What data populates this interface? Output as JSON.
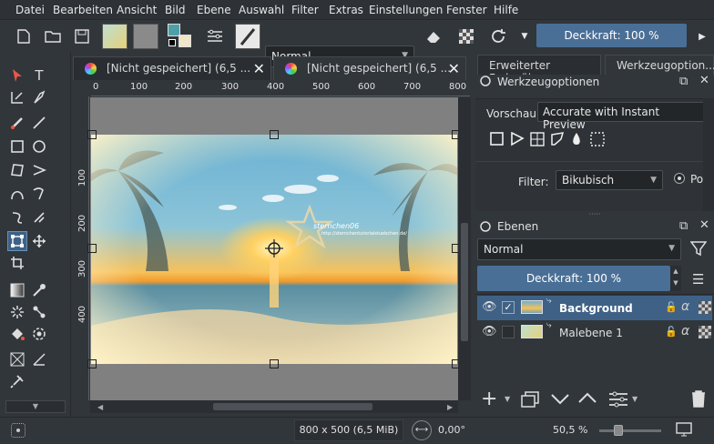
{
  "menu": [
    "Datei",
    "Bearbeiten",
    "Ansicht",
    "Bild",
    "Ebene",
    "Auswahl",
    "Filter",
    "Extras",
    "Einstellungen",
    "Fenster",
    "Hilfe"
  ],
  "toolbar": {
    "blend_mode": "Normal",
    "opacity_label": "Deckkraft: 100 %"
  },
  "document_tabs": [
    {
      "title": "[Nicht gespeichert] (6,5 ..."
    },
    {
      "title": "[Nicht gespeichert] (6,5 ..."
    }
  ],
  "rulers": {
    "top": [
      "0",
      "100",
      "200",
      "300",
      "400",
      "500",
      "600",
      "700",
      "800"
    ],
    "left": [
      "100",
      "200",
      "300",
      "400"
    ]
  },
  "canvas": {
    "watermark": "sternchen06",
    "watermark_url": "http://sternchentutorialstuebchen.de/"
  },
  "right_panel": {
    "tabs": [
      "Erweiterter Farbwäh...",
      "Werkzeugoption..."
    ],
    "tool_options": {
      "title": "Werkzeugoptionen",
      "preview_label": "Vorschau",
      "preview_value": "Accurate with Instant Preview",
      "filter_label": "Filter:",
      "filter_value": "Bikubisch",
      "radio_label": "Po"
    },
    "layers": {
      "title": "Ebenen",
      "blend_mode": "Normal",
      "opacity_label": "Deckkraft:  100 %",
      "items": [
        {
          "name": "Background"
        },
        {
          "name": "Malebene 1"
        }
      ]
    }
  },
  "status": {
    "size": "800 x 500 (6,5 MiB)",
    "angle": "0,00°",
    "zoom": "50,5 %"
  },
  "colors": {
    "accent": "#4a6f96",
    "bg": "#31363b",
    "selected_row": "#3f6186"
  }
}
